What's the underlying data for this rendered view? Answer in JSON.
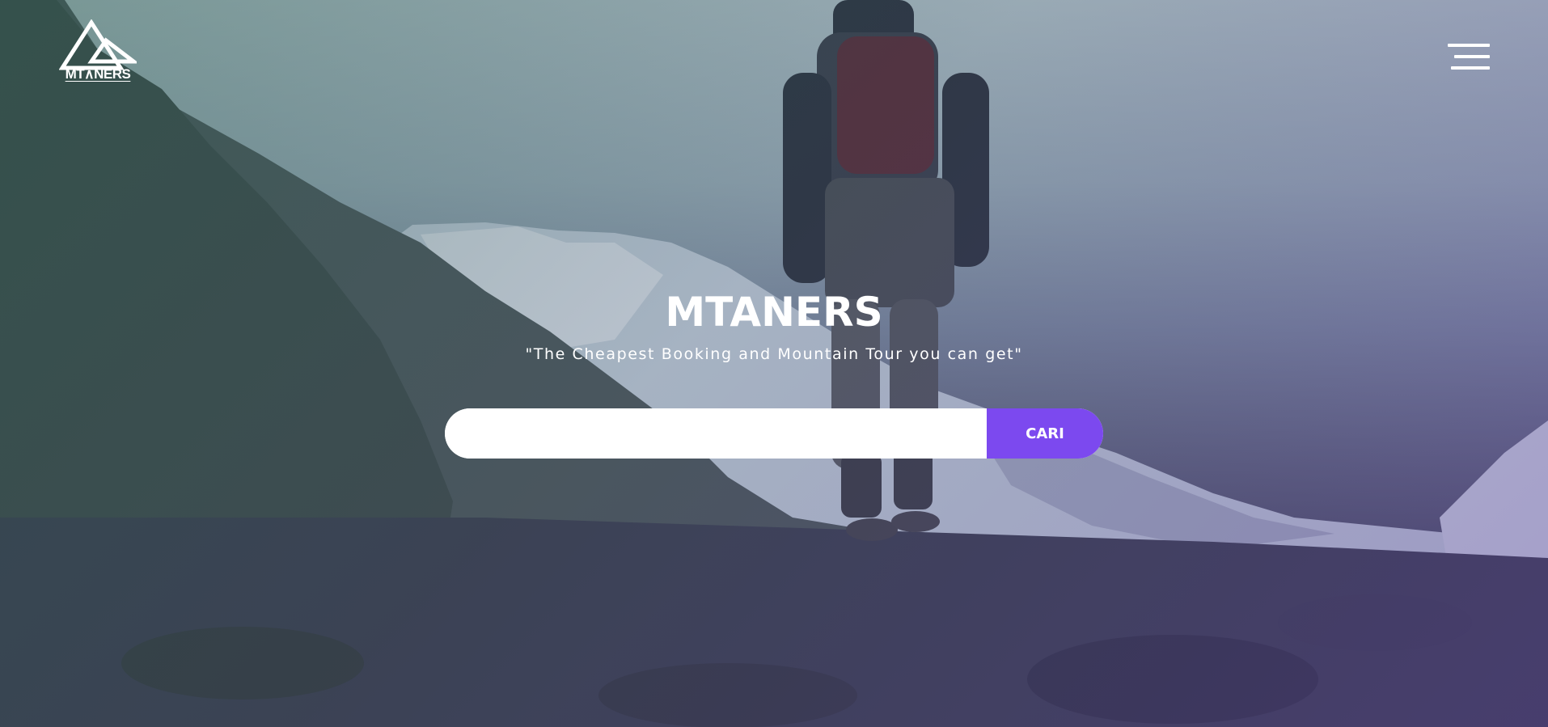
{
  "header": {
    "logo_text": "MT∧NERS",
    "menu_icon": "hamburger-menu-icon"
  },
  "hero": {
    "title": "MTANERS",
    "tagline": "\"The Cheapest Booking and Mountain Tour you can get\"",
    "background_image": "hiker-walking-up-mountain-trail"
  },
  "search": {
    "value": "",
    "placeholder": "",
    "button_label": "CARI"
  },
  "colors": {
    "accent": "#7c49ef",
    "text": "#ffffff"
  }
}
